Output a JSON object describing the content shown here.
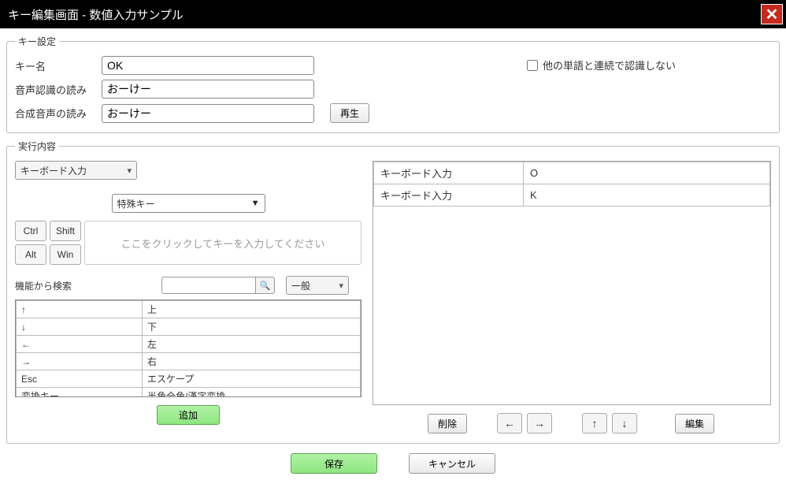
{
  "title": "キー編集画面 - 数値入力サンプル",
  "key_settings": {
    "legend": "キー設定",
    "name_label": "キー名",
    "name_value": "OK",
    "reading_label": "音声認識の読み",
    "reading_value": "おーけー",
    "synth_label": "合成音声の読み",
    "synth_value": "おーけー",
    "play_label": "再生",
    "checkbox_label": "他の単語と連続で認識しない"
  },
  "exec": {
    "legend": "実行内容",
    "input_type": "キーボード入力",
    "special_key": "特殊キー",
    "modifiers": {
      "ctrl": "Ctrl",
      "shift": "Shift",
      "alt": "Alt",
      "win": "Win"
    },
    "key_placeholder": "ここをクリックしてキーを入力してください",
    "search_label": "機能から検索",
    "category": "一般",
    "func_rows": [
      {
        "key": "↑",
        "desc": "上"
      },
      {
        "key": "↓",
        "desc": "下"
      },
      {
        "key": "←",
        "desc": "左"
      },
      {
        "key": "→",
        "desc": "右"
      },
      {
        "key": "Esc",
        "desc": "エスケープ"
      },
      {
        "key": "変換キー",
        "desc": "半角全角/漢字変換"
      }
    ],
    "add_label": "追加",
    "right_rows": [
      {
        "type": "キーボード入力",
        "key": "O"
      },
      {
        "type": "キーボード入力",
        "key": "K"
      }
    ],
    "delete_label": "削除",
    "edit_label": "編集"
  },
  "footer": {
    "save": "保存",
    "cancel": "キャンセル"
  },
  "icons": {
    "arrow_left": "←",
    "arrow_right": "→",
    "arrow_up": "↑",
    "arrow_down": "↓",
    "close": "✕",
    "search": "🔍"
  }
}
